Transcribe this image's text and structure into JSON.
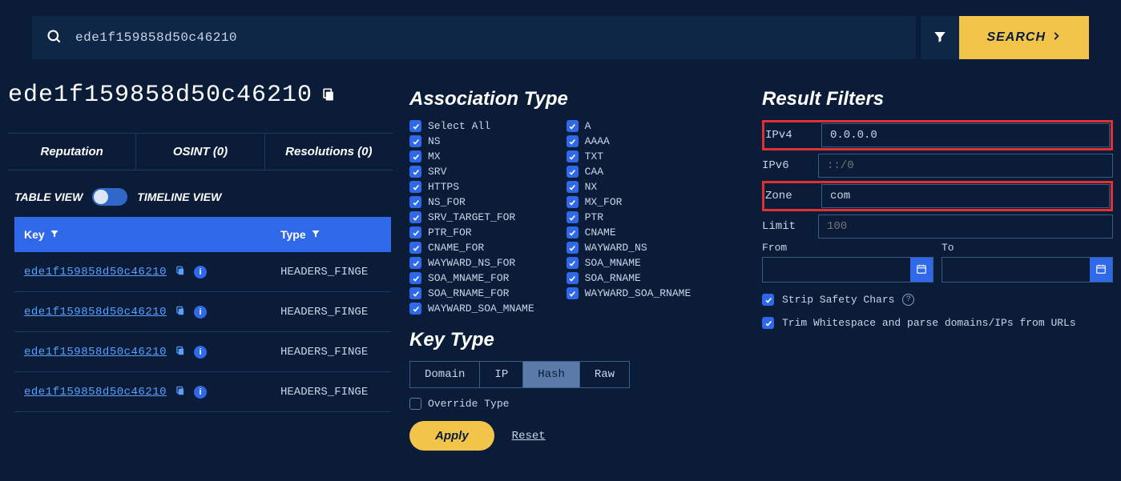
{
  "search": {
    "value": "ede1f159858d50c46210",
    "button": "SEARCH"
  },
  "title": "ede1f159858d50c46210",
  "tabs": [
    {
      "label": "Reputation"
    },
    {
      "label": "OSINT (0)"
    },
    {
      "label": "Resolutions (0)"
    }
  ],
  "view": {
    "table": "TABLE VIEW",
    "timeline": "TIMELINE VIEW"
  },
  "table": {
    "headers": {
      "key": "Key",
      "type": "Type"
    },
    "rows": [
      {
        "key": "ede1f159858d50c46210",
        "type": "HEADERS_FINGE"
      },
      {
        "key": "ede1f159858d50c46210",
        "type": "HEADERS_FINGE"
      },
      {
        "key": "ede1f159858d50c46210",
        "type": "HEADERS_FINGE"
      },
      {
        "key": "ede1f159858d50c46210",
        "type": "HEADERS_FINGE"
      }
    ]
  },
  "assoc": {
    "title": "Association Type",
    "col1": [
      "Select All",
      "NS",
      "MX",
      "SRV",
      "HTTPS",
      "NS_FOR",
      "SRV_TARGET_FOR",
      "PTR_FOR",
      "CNAME_FOR",
      "WAYWARD_NS_FOR",
      "SOA_MNAME_FOR",
      "SOA_RNAME_FOR",
      "WAYWARD_SOA_MNAME"
    ],
    "col2": [
      "A",
      "AAAA",
      "TXT",
      "CAA",
      "NX",
      "MX_FOR",
      "PTR",
      "CNAME",
      "WAYWARD_NS",
      "SOA_MNAME",
      "SOA_RNAME",
      "WAYWARD_SOA_RNAME"
    ]
  },
  "keytype": {
    "title": "Key Type",
    "options": [
      "Domain",
      "IP",
      "Hash",
      "Raw"
    ],
    "active": "Hash",
    "override": "Override Type"
  },
  "actions": {
    "apply": "Apply",
    "reset": "Reset"
  },
  "filters": {
    "title": "Result Filters",
    "ipv4": {
      "label": "IPv4",
      "value": "0.0.0.0"
    },
    "ipv6": {
      "label": "IPv6",
      "placeholder": "::/0"
    },
    "zone": {
      "label": "Zone",
      "value": "com"
    },
    "limit": {
      "label": "Limit",
      "placeholder": "100"
    },
    "from": "From",
    "to": "To",
    "strip": "Strip Safety Chars",
    "trim": "Trim Whitespace and parse domains/IPs from URLs"
  }
}
